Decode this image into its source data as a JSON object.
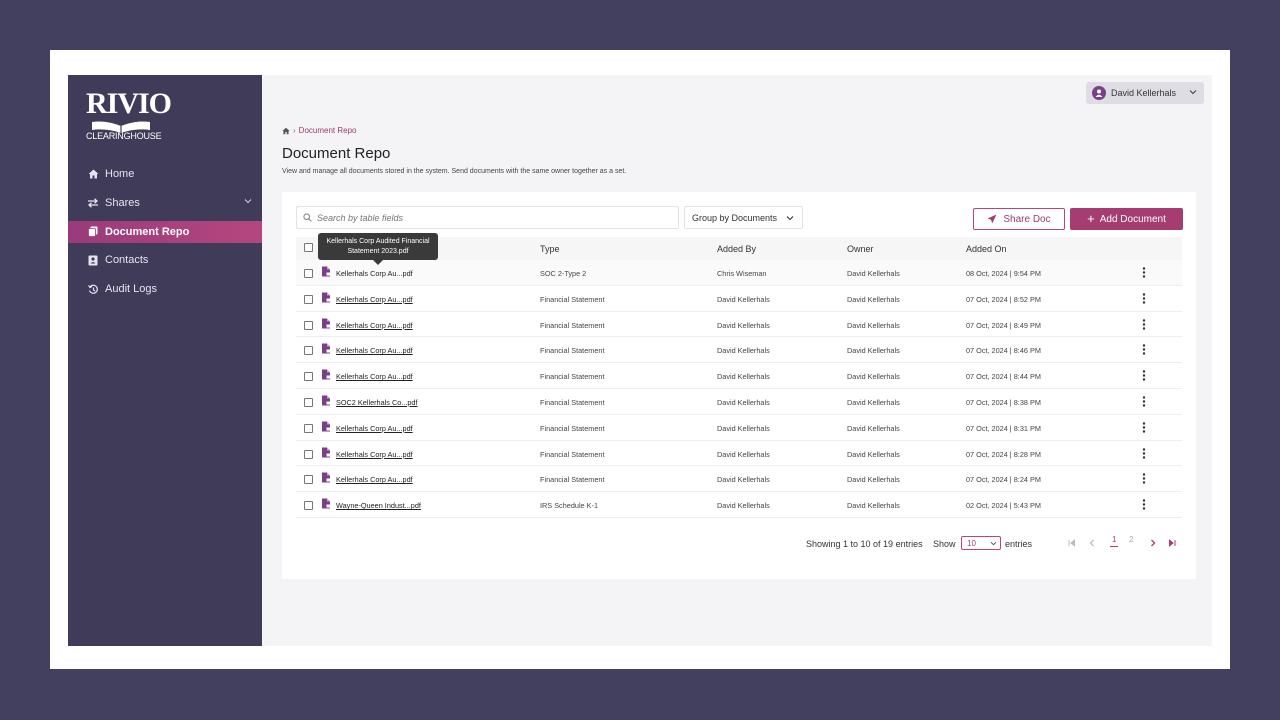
{
  "brand": {
    "name": "RIVIO",
    "subtitle": "CLEARINGHOUSE"
  },
  "sidebar": {
    "items": [
      {
        "label": "Home",
        "icon": "home-icon"
      },
      {
        "label": "Shares",
        "icon": "swap-icon",
        "has_submenu": true
      },
      {
        "label": "Document Repo",
        "icon": "document-icon",
        "active": true
      },
      {
        "label": "Contacts",
        "icon": "contact-icon"
      },
      {
        "label": "Audit Logs",
        "icon": "history-icon"
      }
    ]
  },
  "user": {
    "name": "David Kellerhals"
  },
  "breadcrumb": {
    "current": "Document Repo"
  },
  "page": {
    "title": "Document Repo",
    "description": "View and manage all documents stored in the system. Send documents with the same owner together as a set."
  },
  "toolbar": {
    "search_placeholder": "Search by table fields",
    "group_label": "Group by Documents",
    "share_label": "Share Doc",
    "add_label": "Add Document"
  },
  "table": {
    "headers": {
      "type": "Type",
      "added_by": "Added By",
      "owner": "Owner",
      "added_on": "Added On"
    },
    "tooltip": {
      "line1": "Kellerhals Corp Audited Financial",
      "line2": "Statement 2023.pdf"
    },
    "rows": [
      {
        "name": "Kellerhals Corp Au...pdf",
        "type": "SOC 2-Type 2",
        "added_by": "Chris Wiseman",
        "owner": "David Kellerhals",
        "added_on": "08 Oct, 2024 | 9:54 PM"
      },
      {
        "name": "Kellerhals Corp Au...pdf",
        "type": "Financial Statement",
        "added_by": "David Kellerhals",
        "owner": "David Kellerhals",
        "added_on": "07 Oct, 2024 | 8:52 PM"
      },
      {
        "name": "Kellerhals Corp Au...pdf",
        "type": "Financial Statement",
        "added_by": "David Kellerhals",
        "owner": "David Kellerhals",
        "added_on": "07 Oct, 2024 | 8:49 PM"
      },
      {
        "name": "Kellerhals Corp Au...pdf",
        "type": "Financial Statement",
        "added_by": "David Kellerhals",
        "owner": "David Kellerhals",
        "added_on": "07 Oct, 2024 | 8:46 PM"
      },
      {
        "name": "Kellerhals Corp Au...pdf",
        "type": "Financial Statement",
        "added_by": "David Kellerhals",
        "owner": "David Kellerhals",
        "added_on": "07 Oct, 2024 | 8:44 PM"
      },
      {
        "name": "SOC2 Kellerhals Co...pdf",
        "type": "Financial Statement",
        "added_by": "David Kellerhals",
        "owner": "David Kellerhals",
        "added_on": "07 Oct, 2024 | 8:38 PM"
      },
      {
        "name": "Kellerhals Corp Au...pdf",
        "type": "Financial Statement",
        "added_by": "David Kellerhals",
        "owner": "David Kellerhals",
        "added_on": "07 Oct, 2024 | 8:31 PM"
      },
      {
        "name": "Kellerhals Corp Au...pdf",
        "type": "Financial Statement",
        "added_by": "David Kellerhals",
        "owner": "David Kellerhals",
        "added_on": "07 Oct, 2024 | 8:28 PM"
      },
      {
        "name": "Kellerhals Corp Au...pdf",
        "type": "Financial Statement",
        "added_by": "David Kellerhals",
        "owner": "David Kellerhals",
        "added_on": "07 Oct, 2024 | 8:24 PM"
      },
      {
        "name": "Wayne-Queen Indust...pdf",
        "type": "IRS Schedule K-1",
        "added_by": "David Kellerhals",
        "owner": "David Kellerhals",
        "added_on": "02 Oct, 2024 | 5:43 PM"
      }
    ]
  },
  "pagination": {
    "summary": "Showing 1 to 10 of 19 entries",
    "show_label": "Show",
    "page_size": "10",
    "entries_label": "entries",
    "pages": [
      "1",
      "2"
    ],
    "current_page": "1"
  },
  "colors": {
    "accent": "#a53d73",
    "sidebar_bg": "#3f3b58",
    "active_nav": "#b5477e"
  }
}
